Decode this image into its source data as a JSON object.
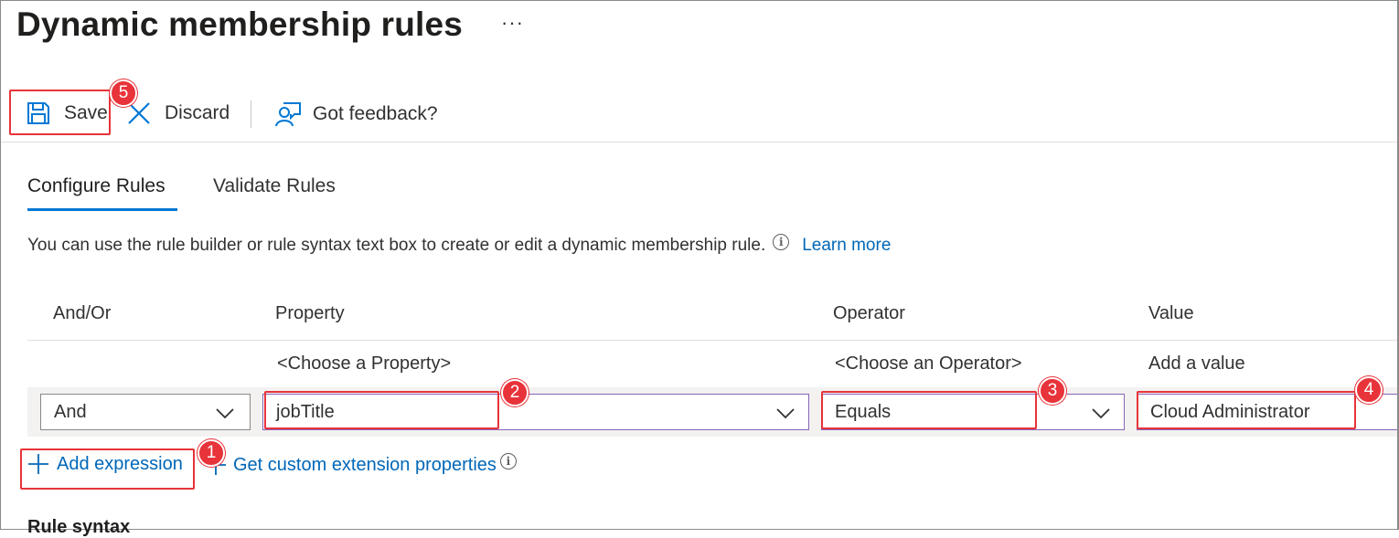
{
  "page": {
    "title": "Dynamic membership rules",
    "more_label": "···"
  },
  "toolbar": {
    "save_label": "Save",
    "discard_label": "Discard",
    "feedback_label": "Got feedback?"
  },
  "tabs": [
    {
      "label": "Configure Rules",
      "selected": true
    },
    {
      "label": "Validate Rules",
      "selected": false
    }
  ],
  "description": {
    "text": "You can use the rule builder or rule syntax text box to create or edit a dynamic membership rule.",
    "info_icon": "i",
    "learn_more": "Learn more"
  },
  "rule_builder": {
    "columns": [
      "And/Or",
      "Property",
      "Operator",
      "Value"
    ],
    "hints": {
      "property": "<Choose a Property>",
      "operator": "<Choose an Operator>",
      "value": "Add a value"
    },
    "row": {
      "and_or": "And",
      "property": "jobTitle",
      "operator": "Equals",
      "value": "Cloud Administrator"
    }
  },
  "actions": {
    "add_expression": "Add expression",
    "get_custom": "Get custom extension properties",
    "info_icon": "i"
  },
  "callouts": [
    "1",
    "2",
    "3",
    "4",
    "5"
  ],
  "section": {
    "rule_syntax": "Rule syntax"
  },
  "colors": {
    "accent": "#0078d4",
    "link": "#0067b8",
    "callout": "#e8333a",
    "dropdown_focus": "#8764b8"
  }
}
